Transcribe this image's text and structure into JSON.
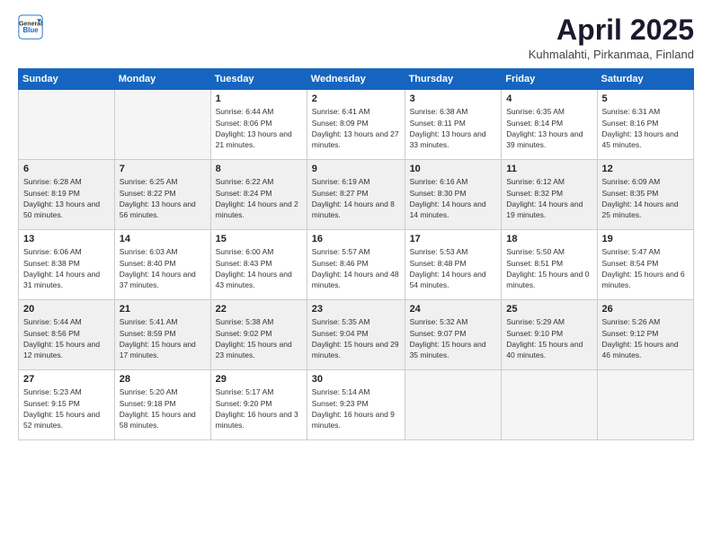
{
  "logo": {
    "general": "General",
    "blue": "Blue"
  },
  "header": {
    "title": "April 2025",
    "subtitle": "Kuhmalahti, Pirkanmaa, Finland"
  },
  "weekdays": [
    "Sunday",
    "Monday",
    "Tuesday",
    "Wednesday",
    "Thursday",
    "Friday",
    "Saturday"
  ],
  "weeks": [
    [
      {
        "day": "",
        "empty": true
      },
      {
        "day": "",
        "empty": true
      },
      {
        "day": "1",
        "sunrise": "Sunrise: 6:44 AM",
        "sunset": "Sunset: 8:06 PM",
        "daylight": "Daylight: 13 hours and 21 minutes."
      },
      {
        "day": "2",
        "sunrise": "Sunrise: 6:41 AM",
        "sunset": "Sunset: 8:09 PM",
        "daylight": "Daylight: 13 hours and 27 minutes."
      },
      {
        "day": "3",
        "sunrise": "Sunrise: 6:38 AM",
        "sunset": "Sunset: 8:11 PM",
        "daylight": "Daylight: 13 hours and 33 minutes."
      },
      {
        "day": "4",
        "sunrise": "Sunrise: 6:35 AM",
        "sunset": "Sunset: 8:14 PM",
        "daylight": "Daylight: 13 hours and 39 minutes."
      },
      {
        "day": "5",
        "sunrise": "Sunrise: 6:31 AM",
        "sunset": "Sunset: 8:16 PM",
        "daylight": "Daylight: 13 hours and 45 minutes."
      }
    ],
    [
      {
        "day": "6",
        "sunrise": "Sunrise: 6:28 AM",
        "sunset": "Sunset: 8:19 PM",
        "daylight": "Daylight: 13 hours and 50 minutes."
      },
      {
        "day": "7",
        "sunrise": "Sunrise: 6:25 AM",
        "sunset": "Sunset: 8:22 PM",
        "daylight": "Daylight: 13 hours and 56 minutes."
      },
      {
        "day": "8",
        "sunrise": "Sunrise: 6:22 AM",
        "sunset": "Sunset: 8:24 PM",
        "daylight": "Daylight: 14 hours and 2 minutes."
      },
      {
        "day": "9",
        "sunrise": "Sunrise: 6:19 AM",
        "sunset": "Sunset: 8:27 PM",
        "daylight": "Daylight: 14 hours and 8 minutes."
      },
      {
        "day": "10",
        "sunrise": "Sunrise: 6:16 AM",
        "sunset": "Sunset: 8:30 PM",
        "daylight": "Daylight: 14 hours and 14 minutes."
      },
      {
        "day": "11",
        "sunrise": "Sunrise: 6:12 AM",
        "sunset": "Sunset: 8:32 PM",
        "daylight": "Daylight: 14 hours and 19 minutes."
      },
      {
        "day": "12",
        "sunrise": "Sunrise: 6:09 AM",
        "sunset": "Sunset: 8:35 PM",
        "daylight": "Daylight: 14 hours and 25 minutes."
      }
    ],
    [
      {
        "day": "13",
        "sunrise": "Sunrise: 6:06 AM",
        "sunset": "Sunset: 8:38 PM",
        "daylight": "Daylight: 14 hours and 31 minutes."
      },
      {
        "day": "14",
        "sunrise": "Sunrise: 6:03 AM",
        "sunset": "Sunset: 8:40 PM",
        "daylight": "Daylight: 14 hours and 37 minutes."
      },
      {
        "day": "15",
        "sunrise": "Sunrise: 6:00 AM",
        "sunset": "Sunset: 8:43 PM",
        "daylight": "Daylight: 14 hours and 43 minutes."
      },
      {
        "day": "16",
        "sunrise": "Sunrise: 5:57 AM",
        "sunset": "Sunset: 8:46 PM",
        "daylight": "Daylight: 14 hours and 48 minutes."
      },
      {
        "day": "17",
        "sunrise": "Sunrise: 5:53 AM",
        "sunset": "Sunset: 8:48 PM",
        "daylight": "Daylight: 14 hours and 54 minutes."
      },
      {
        "day": "18",
        "sunrise": "Sunrise: 5:50 AM",
        "sunset": "Sunset: 8:51 PM",
        "daylight": "Daylight: 15 hours and 0 minutes."
      },
      {
        "day": "19",
        "sunrise": "Sunrise: 5:47 AM",
        "sunset": "Sunset: 8:54 PM",
        "daylight": "Daylight: 15 hours and 6 minutes."
      }
    ],
    [
      {
        "day": "20",
        "sunrise": "Sunrise: 5:44 AM",
        "sunset": "Sunset: 8:56 PM",
        "daylight": "Daylight: 15 hours and 12 minutes."
      },
      {
        "day": "21",
        "sunrise": "Sunrise: 5:41 AM",
        "sunset": "Sunset: 8:59 PM",
        "daylight": "Daylight: 15 hours and 17 minutes."
      },
      {
        "day": "22",
        "sunrise": "Sunrise: 5:38 AM",
        "sunset": "Sunset: 9:02 PM",
        "daylight": "Daylight: 15 hours and 23 minutes."
      },
      {
        "day": "23",
        "sunrise": "Sunrise: 5:35 AM",
        "sunset": "Sunset: 9:04 PM",
        "daylight": "Daylight: 15 hours and 29 minutes."
      },
      {
        "day": "24",
        "sunrise": "Sunrise: 5:32 AM",
        "sunset": "Sunset: 9:07 PM",
        "daylight": "Daylight: 15 hours and 35 minutes."
      },
      {
        "day": "25",
        "sunrise": "Sunrise: 5:29 AM",
        "sunset": "Sunset: 9:10 PM",
        "daylight": "Daylight: 15 hours and 40 minutes."
      },
      {
        "day": "26",
        "sunrise": "Sunrise: 5:26 AM",
        "sunset": "Sunset: 9:12 PM",
        "daylight": "Daylight: 15 hours and 46 minutes."
      }
    ],
    [
      {
        "day": "27",
        "sunrise": "Sunrise: 5:23 AM",
        "sunset": "Sunset: 9:15 PM",
        "daylight": "Daylight: 15 hours and 52 minutes."
      },
      {
        "day": "28",
        "sunrise": "Sunrise: 5:20 AM",
        "sunset": "Sunset: 9:18 PM",
        "daylight": "Daylight: 15 hours and 58 minutes."
      },
      {
        "day": "29",
        "sunrise": "Sunrise: 5:17 AM",
        "sunset": "Sunset: 9:20 PM",
        "daylight": "Daylight: 16 hours and 3 minutes."
      },
      {
        "day": "30",
        "sunrise": "Sunrise: 5:14 AM",
        "sunset": "Sunset: 9:23 PM",
        "daylight": "Daylight: 16 hours and 9 minutes."
      },
      {
        "day": "",
        "empty": true
      },
      {
        "day": "",
        "empty": true
      },
      {
        "day": "",
        "empty": true
      }
    ]
  ]
}
